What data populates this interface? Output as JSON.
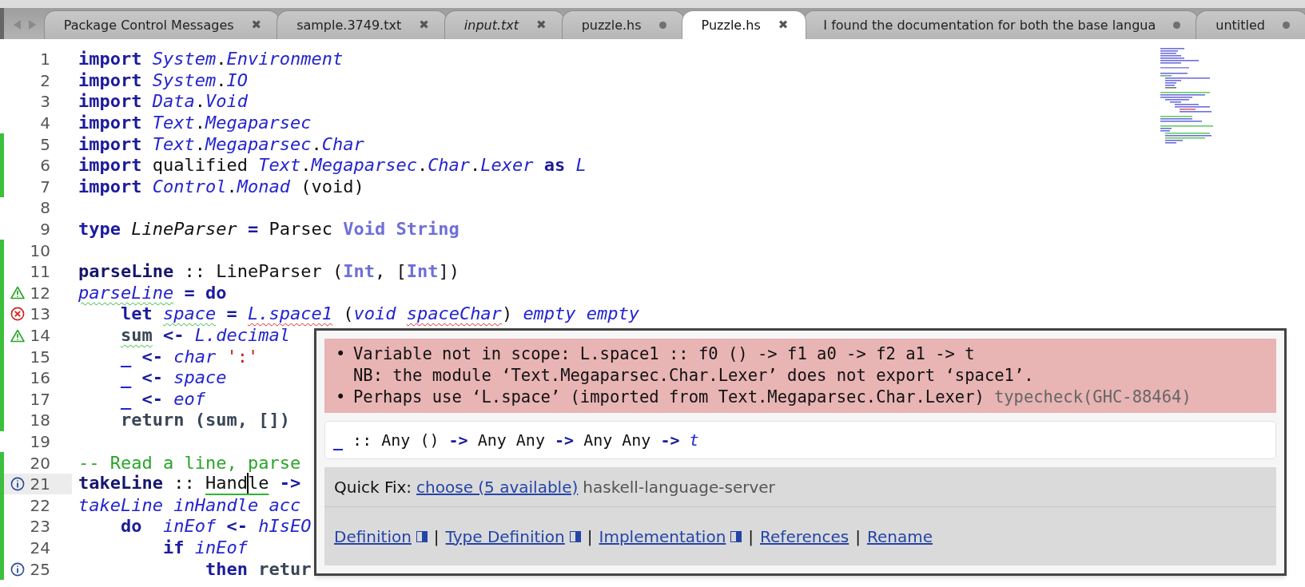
{
  "tabs": [
    {
      "label": "Package Control Messages",
      "selected": false,
      "italic": false,
      "dirty": false,
      "close": "✖"
    },
    {
      "label": "sample.3749.txt",
      "selected": false,
      "italic": false,
      "dirty": false,
      "close": "✖"
    },
    {
      "label": "input.txt",
      "selected": false,
      "italic": true,
      "dirty": false,
      "close": "✖"
    },
    {
      "label": "puzzle.hs",
      "selected": false,
      "italic": false,
      "dirty": true
    },
    {
      "label": "Puzzle.hs",
      "selected": true,
      "italic": false,
      "dirty": false,
      "close": "✖"
    },
    {
      "label": "I found the documentation for both the base langua",
      "selected": false,
      "italic": false,
      "dirty": true
    },
    {
      "label": "untitled",
      "selected": false,
      "italic": false,
      "dirty": true
    }
  ],
  "editor": {
    "lines": [
      {
        "number": "1",
        "changed": false,
        "current": false,
        "tokens": [
          {
            "t": "import ",
            "kind": "kw"
          },
          {
            "t": "System",
            "kind": "mod"
          },
          {
            "t": ".",
            "kind": "plain"
          },
          {
            "t": "Environment",
            "kind": "mod"
          }
        ]
      },
      {
        "number": "2",
        "changed": false,
        "current": false,
        "tokens": [
          {
            "t": "import ",
            "kind": "kw"
          },
          {
            "t": "System",
            "kind": "mod"
          },
          {
            "t": ".",
            "kind": "plain"
          },
          {
            "t": "IO",
            "kind": "mod"
          }
        ]
      },
      {
        "number": "3",
        "changed": false,
        "current": false,
        "tokens": [
          {
            "t": "import ",
            "kind": "kw"
          },
          {
            "t": "Data",
            "kind": "mod"
          },
          {
            "t": ".",
            "kind": "plain"
          },
          {
            "t": "Void",
            "kind": "mod"
          }
        ]
      },
      {
        "number": "4",
        "changed": false,
        "current": false,
        "tokens": [
          {
            "t": "import ",
            "kind": "kw"
          },
          {
            "t": "Text",
            "kind": "mod"
          },
          {
            "t": ".",
            "kind": "plain"
          },
          {
            "t": "Megaparsec",
            "kind": "mod"
          }
        ]
      },
      {
        "number": "5",
        "changed": true,
        "current": false,
        "tokens": [
          {
            "t": "import ",
            "kind": "kw"
          },
          {
            "t": "Text",
            "kind": "mod"
          },
          {
            "t": ".",
            "kind": "plain"
          },
          {
            "t": "Megaparsec",
            "kind": "mod"
          },
          {
            "t": ".",
            "kind": "plain"
          },
          {
            "t": "Char",
            "kind": "mod"
          }
        ]
      },
      {
        "number": "6",
        "changed": true,
        "current": false,
        "tokens": [
          {
            "t": "import",
            "kind": "kw"
          },
          {
            "t": " qualified ",
            "kind": "plain"
          },
          {
            "t": "Text",
            "kind": "mod"
          },
          {
            "t": ".",
            "kind": "plain"
          },
          {
            "t": "Megaparsec",
            "kind": "mod"
          },
          {
            "t": ".",
            "kind": "plain"
          },
          {
            "t": "Char",
            "kind": "mod"
          },
          {
            "t": ".",
            "kind": "plain"
          },
          {
            "t": "Lexer ",
            "kind": "mod"
          },
          {
            "t": "as ",
            "kind": "kw"
          },
          {
            "t": "L",
            "kind": "mod"
          }
        ]
      },
      {
        "number": "7",
        "changed": true,
        "current": false,
        "tokens": [
          {
            "t": "import ",
            "kind": "kw"
          },
          {
            "t": "Control",
            "kind": "mod"
          },
          {
            "t": ".",
            "kind": "plain"
          },
          {
            "t": "Monad",
            "kind": "mod"
          },
          {
            "t": " (void)",
            "kind": "plain"
          }
        ]
      },
      {
        "number": "8",
        "changed": false,
        "current": false
      },
      {
        "number": "9",
        "changed": false,
        "current": false,
        "tokens": [
          {
            "t": "type ",
            "kind": "kw"
          },
          {
            "t": "LineParser ",
            "kind": "tname"
          },
          {
            "t": "=",
            "kind": "kw"
          },
          {
            "t": " Parsec ",
            "kind": "plain"
          },
          {
            "t": "Void String",
            "kind": "type"
          }
        ]
      },
      {
        "number": "10",
        "changed": true,
        "current": false
      },
      {
        "number": "11",
        "changed": true,
        "current": false,
        "tokens": [
          {
            "t": "parseLine",
            "kind": "fn"
          },
          {
            "t": " :: LineParser (",
            "kind": "plain"
          },
          {
            "t": "Int",
            "kind": "type"
          },
          {
            "t": ", [",
            "kind": "plain"
          },
          {
            "t": "Int",
            "kind": "type"
          },
          {
            "t": "])",
            "kind": "plain"
          }
        ]
      },
      {
        "number": "12",
        "changed": true,
        "current": false,
        "marker": {
          "kind": "warning"
        },
        "tokens": [
          {
            "t": "parseLine",
            "kind": "var",
            "underline": {
              "kind": "warning"
            }
          },
          {
            "t": " = do",
            "kind": "kw"
          }
        ]
      },
      {
        "number": "13",
        "changed": true,
        "current": false,
        "marker": {
          "kind": "error"
        },
        "tokens": [
          {
            "t": "    let ",
            "kind": "kw"
          },
          {
            "t": "space",
            "kind": "var",
            "underline": {
              "kind": "warning"
            }
          },
          {
            "t": " = ",
            "kind": "kw"
          },
          {
            "t": "L.space1",
            "kind": "var",
            "underline": {
              "kind": "error"
            }
          },
          {
            "t": " (",
            "kind": "plain"
          },
          {
            "t": "void ",
            "kind": "var"
          },
          {
            "t": "spaceChar",
            "kind": "var",
            "underline": {
              "kind": "error"
            }
          },
          {
            "t": ") ",
            "kind": "plain"
          },
          {
            "t": "empty empty",
            "kind": "var"
          }
        ]
      },
      {
        "number": "14",
        "changed": true,
        "current": false,
        "marker": {
          "kind": "warning"
        },
        "tokens": [
          {
            "t": "    sum",
            "kind": "bold",
            "underline": {
              "kind": "warning"
            }
          },
          {
            "t": " <- ",
            "kind": "kw"
          },
          {
            "t": "L.decimal",
            "kind": "var"
          }
        ]
      },
      {
        "number": "15",
        "changed": true,
        "current": false,
        "tokens": [
          {
            "t": "    _",
            "kind": "hole"
          },
          {
            "t": " <- ",
            "kind": "kw"
          },
          {
            "t": "char ",
            "kind": "var"
          },
          {
            "t": "':'",
            "kind": "str"
          }
        ]
      },
      {
        "number": "16",
        "changed": true,
        "current": false,
        "tokens": [
          {
            "t": "    _",
            "kind": "hole"
          },
          {
            "t": " <- ",
            "kind": "kw"
          },
          {
            "t": "space",
            "kind": "var"
          }
        ]
      },
      {
        "number": "17",
        "changed": true,
        "current": false,
        "tokens": [
          {
            "t": "    _",
            "kind": "hole"
          },
          {
            "t": " <- ",
            "kind": "kw"
          },
          {
            "t": "eof",
            "kind": "var"
          }
        ]
      },
      {
        "number": "18",
        "changed": true,
        "current": false,
        "tokens": [
          {
            "t": "    return (sum, [])",
            "kind": "bold"
          }
        ]
      },
      {
        "number": "19",
        "changed": false,
        "current": false
      },
      {
        "number": "20",
        "changed": true,
        "current": false,
        "tokens": [
          {
            "t": "-- Read a line, parse",
            "kind": "comment"
          }
        ]
      },
      {
        "number": "21",
        "changed": true,
        "current": true,
        "marker": {
          "kind": "info"
        },
        "tokens": [
          {
            "t": "takeLine",
            "kind": "fn"
          },
          {
            "t": " :: ",
            "kind": "plain"
          },
          {
            "t": "Hand",
            "kind": "plain",
            "underline": {
              "kind": "hint"
            },
            "caret": true
          },
          {
            "t": "le",
            "kind": "plain",
            "underline": {
              "kind": "hint"
            }
          },
          {
            "t": " ->",
            "kind": "kw"
          }
        ]
      },
      {
        "number": "22",
        "changed": true,
        "current": false,
        "tokens": [
          {
            "t": "takeLine inHandle acc",
            "kind": "var"
          }
        ]
      },
      {
        "number": "23",
        "changed": true,
        "current": false,
        "tokens": [
          {
            "t": "    do  ",
            "kind": "kw"
          },
          {
            "t": "inEof",
            "kind": "var"
          },
          {
            "t": " <- ",
            "kind": "kw"
          },
          {
            "t": "hIsEO",
            "kind": "var"
          }
        ]
      },
      {
        "number": "24",
        "changed": true,
        "current": false,
        "tokens": [
          {
            "t": "        if ",
            "kind": "kw"
          },
          {
            "t": "inEof",
            "kind": "var"
          }
        ]
      },
      {
        "number": "25",
        "changed": true,
        "current": false,
        "marker": {
          "kind": "info"
        },
        "tokens": [
          {
            "t": "            then ",
            "kind": "kw"
          },
          {
            "t": "retur",
            "kind": "bold"
          }
        ]
      }
    ]
  },
  "popup": {
    "error": {
      "lines": [
        {
          "bullet": "•",
          "text": "Variable not in scope: L.space1 :: f0 () -> f1 a0 -> f2 a1 -> t"
        },
        {
          "text": "NB: the module ‘Text.Megaparsec.Char.Lexer’ does not export ‘space1’."
        },
        {
          "bullet": "•",
          "text": "Perhaps use ‘L.space’ (imported from Text.Megaparsec.Char.Lexer)",
          "source": "typecheck(GHC-88464)"
        }
      ]
    },
    "type_hint": [
      {
        "t": "_",
        "kind": "hole"
      },
      {
        "t": " :: Any () ",
        "kind": "plain"
      },
      {
        "t": "->",
        "kind": "kw"
      },
      {
        "t": " Any Any ",
        "kind": "plain"
      },
      {
        "t": "->",
        "kind": "kw"
      },
      {
        "t": " Any Any ",
        "kind": "plain"
      },
      {
        "t": "->",
        "kind": "kw"
      },
      {
        "t": " t",
        "kind": "var"
      }
    ],
    "quick_fix": {
      "label": "Quick Fix:",
      "link": "choose (5 available)",
      "source": "haskell-language-server"
    },
    "actions": [
      {
        "kind": "link",
        "label": "Definition",
        "split": true
      },
      {
        "kind": "separator",
        "label": "|"
      },
      {
        "kind": "link",
        "label": "Type Definition",
        "split": true
      },
      {
        "kind": "separator",
        "label": "|"
      },
      {
        "kind": "link",
        "label": "Implementation",
        "split": true
      },
      {
        "kind": "separator",
        "label": "|"
      },
      {
        "kind": "link",
        "label": "References",
        "split": false
      },
      {
        "kind": "separator",
        "label": "|"
      },
      {
        "kind": "link",
        "label": "Rename",
        "split": false
      }
    ]
  }
}
